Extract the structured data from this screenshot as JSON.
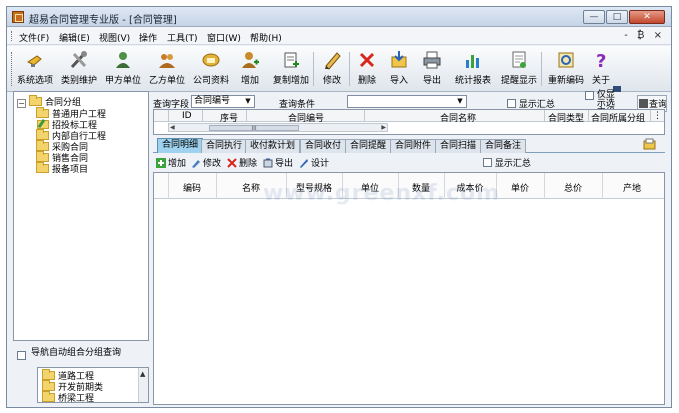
{
  "window": {
    "title": "超易合同管理专业版 - [合同管理]",
    "minimize": "—",
    "maximize": "□",
    "close": "✕"
  },
  "menu": {
    "items": [
      "文件(F)",
      "编辑(E)",
      "视图(V)",
      "操作",
      "工具(T)",
      "窗口(W)",
      "帮助(H)"
    ],
    "mdi_controls": "- ₿ ×"
  },
  "toolbar": {
    "buttons": [
      {
        "label": "系统选项",
        "icon": "lightbulb-icon"
      },
      {
        "label": "类别维护",
        "icon": "tools-icon"
      },
      {
        "label": "甲方单位",
        "icon": "person-icon"
      },
      {
        "label": "乙方单位",
        "icon": "person-group-icon"
      },
      {
        "label": "公司资料",
        "icon": "company-icon"
      },
      {
        "label": "增加",
        "icon": "add-user-icon"
      },
      {
        "label": "复制增加",
        "icon": "copy-add-icon"
      },
      {
        "label": "修改",
        "icon": "pencil-icon"
      },
      {
        "label": "删除",
        "icon": "delete-x-icon"
      },
      {
        "label": "导入",
        "icon": "import-icon"
      },
      {
        "label": "导出",
        "icon": "export-printer-icon"
      },
      {
        "label": "统计报表",
        "icon": "chart-icon"
      },
      {
        "label": "提醒显示",
        "icon": "reminder-icon"
      },
      {
        "label": "重新编码",
        "icon": "recode-icon"
      },
      {
        "label": "关于",
        "icon": "question-icon"
      }
    ]
  },
  "tree": {
    "root": "合同分组",
    "items": [
      "普通用户工程",
      "招投标工程",
      "内部自行工程",
      "采购合同",
      "销售合同",
      "报备项目"
    ]
  },
  "auto_group": {
    "label": "导航自动组合分组查询",
    "items": [
      "道路工程",
      "开发前期类",
      "桥梁工程"
    ]
  },
  "query": {
    "field_label": "查询字段",
    "field_value": "合同编号",
    "condition_label": "查询条件",
    "condition_value": "",
    "show_summary": "显示汇总",
    "only_show_label": "仅显示选定组",
    "query_button": "查询"
  },
  "top_grid": {
    "headers": [
      "ID",
      "序号",
      "合同编号",
      "合同名称",
      "合同类型",
      "合同所属分组"
    ],
    "scroll_thumb": "III"
  },
  "tabs": [
    "合同明细",
    "合同执行",
    "收付款计划",
    "合同收付",
    "合同提醒",
    "合同附件",
    "合同扫描",
    "合同备注"
  ],
  "detail_toolbar": {
    "add": "增加",
    "edit": "修改",
    "delete": "删除",
    "export": "导出",
    "design": "设计",
    "show_summary": "显示汇总"
  },
  "detail_grid": {
    "headers": [
      "编码",
      "名称",
      "型号规格",
      "单位",
      "数量",
      "成本价",
      "单价",
      "总价",
      "产地"
    ]
  },
  "watermark": "www.greenxf.com",
  "colors": {
    "active_tab": "#9ed2ee",
    "folder": "#f3d36b",
    "delete_red": "#d8261c"
  }
}
